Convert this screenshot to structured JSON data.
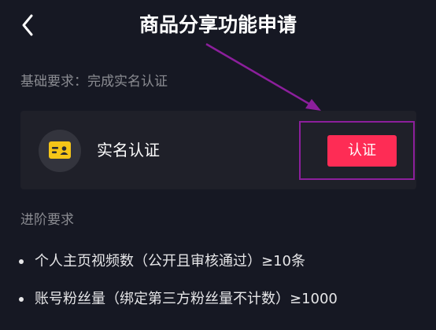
{
  "header": {
    "title": "商品分享功能申请",
    "back_icon": "chevron-left-icon"
  },
  "basic_requirement": {
    "label": "基础要求：完成实名认证",
    "card": {
      "icon": "id-card-icon",
      "label": "实名认证",
      "button_label": "认证"
    }
  },
  "advanced_requirement": {
    "label": "进阶要求",
    "items": [
      "个人主页视频数（公开且审核通过）≥10条",
      "账号粉丝量（绑定第三方粉丝量不计数）≥1000"
    ]
  },
  "colors": {
    "background": "#161823",
    "card": "#1f2029",
    "accent": "#fe2c55",
    "annotation": "#8c1f9c",
    "icon": "#f5c518"
  }
}
